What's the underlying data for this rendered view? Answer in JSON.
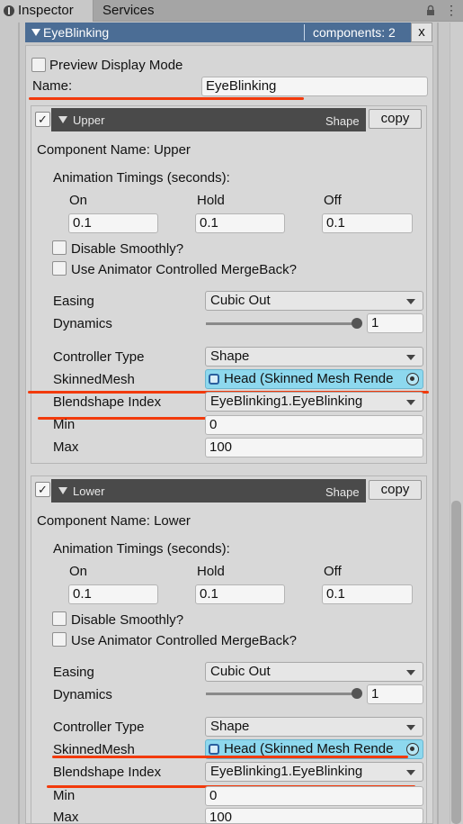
{
  "tabs": {
    "inspector": "Inspector",
    "services": "Services"
  },
  "header": {
    "title": "EyeBlinking",
    "count": "components: 2",
    "close": "x"
  },
  "preview_mode": "Preview Display Mode",
  "name_field": {
    "label": "Name:",
    "value": "EyeBlinking"
  },
  "components": [
    {
      "header_name": "Upper",
      "header_type": "Shape",
      "copy": "copy",
      "check": "✓",
      "component_name": "Component Name: Upper",
      "timings_title": "Animation Timings (seconds):",
      "on_label": "On",
      "hold_label": "Hold",
      "off_label": "Off",
      "on": "0.1",
      "hold": "0.1",
      "off": "0.1",
      "disable_smoothly": "Disable Smoothly?",
      "merge_back": "Use Animator Controlled MergeBack?",
      "easing_label": "Easing",
      "easing_value": "Cubic Out",
      "dynamics_label": "Dynamics",
      "dynamics_value": "1",
      "controller_label": "Controller Type",
      "controller_value": "Shape",
      "skinned_label": "SkinnedMesh",
      "skinned_value": "Head (Skinned Mesh Rende",
      "blend_label": "Blendshape Index",
      "blend_value": "EyeBlinking1.EyeBlinking",
      "min_label": "Min",
      "min_value": "0",
      "max_label": "Max",
      "max_value": "100"
    },
    {
      "header_name": "Lower",
      "header_type": "Shape",
      "copy": "copy",
      "check": "✓",
      "component_name": "Component Name: Lower",
      "timings_title": "Animation Timings (seconds):",
      "on_label": "On",
      "hold_label": "Hold",
      "off_label": "Off",
      "on": "0.1",
      "hold": "0.1",
      "off": "0.1",
      "disable_smoothly": "Disable Smoothly?",
      "merge_back": "Use Animator Controlled MergeBack?",
      "easing_label": "Easing",
      "easing_value": "Cubic Out",
      "dynamics_label": "Dynamics",
      "dynamics_value": "1",
      "controller_label": "Controller Type",
      "controller_value": "Shape",
      "skinned_label": "SkinnedMesh",
      "skinned_value": "Head (Skinned Mesh Rende",
      "blend_label": "Blendshape Index",
      "blend_value": "EyeBlinking1.EyeBlinking",
      "min_label": "Min",
      "min_value": "0",
      "max_label": "Max",
      "max_value": "100"
    }
  ],
  "colors": {
    "annotation_red": "#f23a0c",
    "header_blue": "#4b6d95",
    "object_field": "#8dd8ee"
  },
  "icons": {
    "tab": "inspector-icon",
    "lock": "lock-icon",
    "menu": "kebab-menu-icon",
    "object": "skinned-mesh-icon",
    "picker": "object-picker-icon"
  }
}
